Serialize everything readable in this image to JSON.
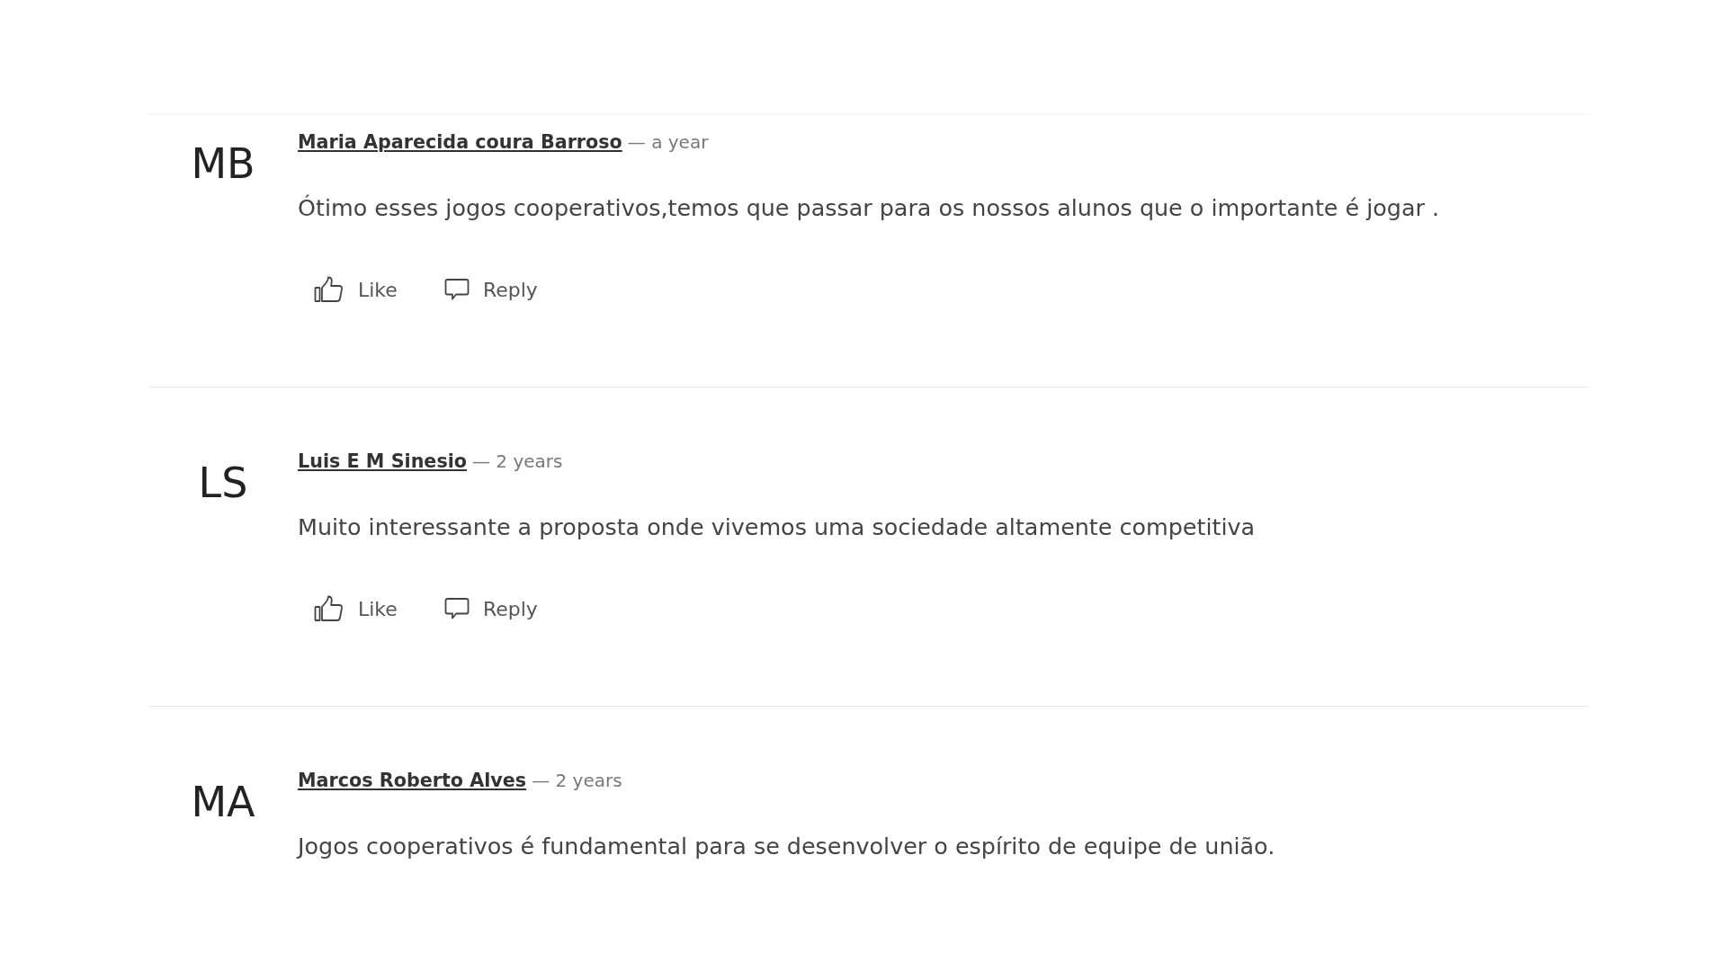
{
  "comments": [
    {
      "initials": "MB",
      "author": "Maria Aparecida coura Barroso",
      "time": "— a year",
      "text": "Ótimo esses jogos cooperativos,temos que passar para os nossos alunos que o importante é jogar .",
      "actions": [
        {
          "kind": "like",
          "label": "Like"
        },
        {
          "kind": "reply",
          "label": "Reply"
        }
      ]
    },
    {
      "initials": "LS",
      "author": "Luis E M Sinesio",
      "time": "— 2 years",
      "text": "Muito interessante a proposta onde vivemos uma sociedade altamente competitiva",
      "actions": [
        {
          "kind": "like",
          "label": "Like"
        },
        {
          "kind": "reply",
          "label": "Reply"
        }
      ]
    },
    {
      "initials": "MA",
      "author": "Marcos Roberto Alves",
      "time": "— 2 years",
      "text": "Jogos cooperativos é fundamental para se desenvolver o espírito de equipe de união."
    }
  ]
}
